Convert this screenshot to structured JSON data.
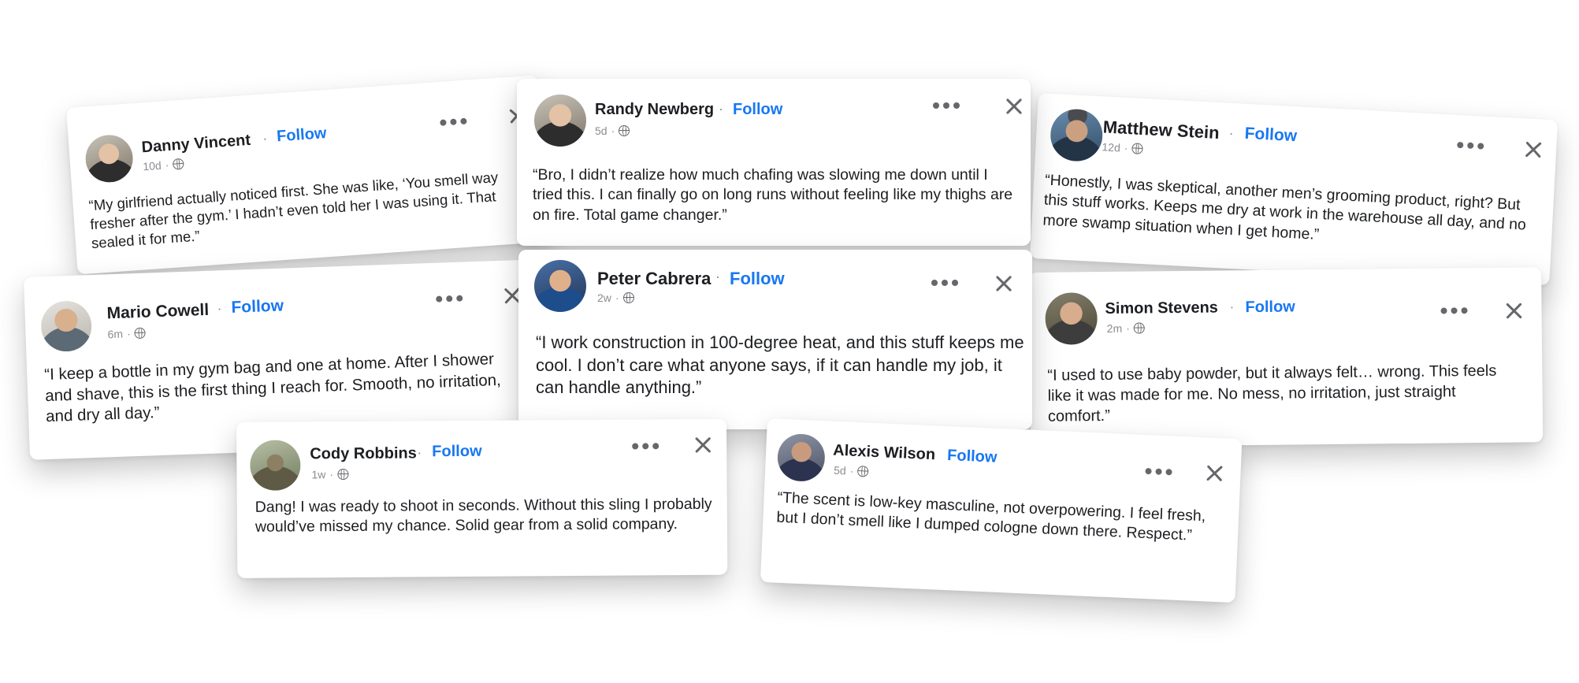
{
  "separator": "·",
  "cards": [
    {
      "name": "Danny Vincent",
      "time": "10d",
      "follow": "Follow",
      "text": "“My girlfriend actually noticed first. She was like, ‘You smell way fresher after the gym.’ I hadn’t even told her I was using it. That sealed it for me.”"
    },
    {
      "name": "Randy Newberg",
      "time": "5d",
      "follow": "Follow",
      "text": "“Bro, I didn’t realize how much chafing was slowing me down until I tried this. I can finally go on long runs without feeling like my thighs are on fire. Total game changer.”"
    },
    {
      "name": "Matthew Stein",
      "time": "12d",
      "follow": "Follow",
      "text": "“Honestly, I was skeptical, another men’s grooming product, right? But this stuff works. Keeps me dry at work in the warehouse all day, and no more swamp situation when I get home.”"
    },
    {
      "name": "Mario Cowell",
      "time": "6m",
      "follow": "Follow",
      "text": "“I keep a bottle in my gym bag and one at home. After I shower and shave, this is the first thing I reach for. Smooth, no irritation, and dry all day.”"
    },
    {
      "name": "Peter Cabrera",
      "time": "2w",
      "follow": "Follow",
      "text": "“I work construction in 100-degree heat, and this stuff keeps me cool. I don’t care what anyone says, if it can handle my job, it can handle anything.”"
    },
    {
      "name": "Simon Stevens",
      "time": "2m",
      "follow": "Follow",
      "text": "“I used to use baby powder, but it always felt… wrong. This feels like it was made for me. No mess, no irritation, just straight comfort.”"
    },
    {
      "name": "Cody Robbins",
      "time": "1w",
      "follow": "Follow",
      "text": "Dang! I was ready to shoot in seconds. Without this sling  I probably would’ve missed my chance. Solid gear from a solid company."
    },
    {
      "name": "Alexis Wilson",
      "time": "5d",
      "follow": "Follow",
      "text": "“The scent is low-key masculine, not overpowering. I feel fresh, but I don’t smell like I dumped cologne down there. Respect.”"
    }
  ]
}
